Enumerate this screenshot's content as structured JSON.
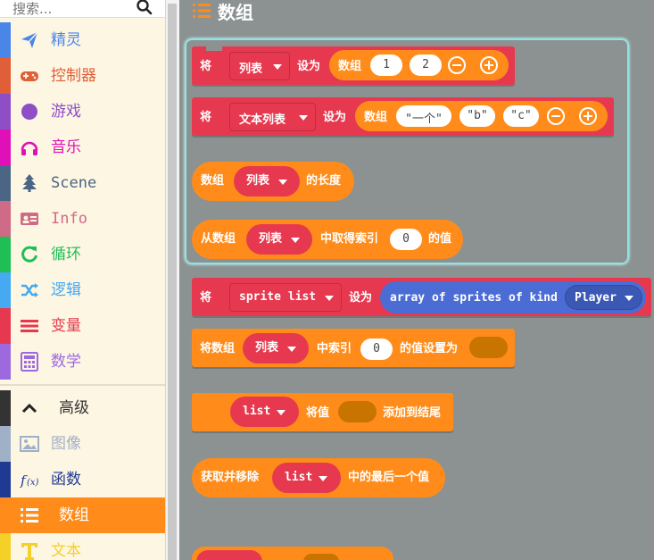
{
  "search": {
    "placeholder": "搜索..."
  },
  "categories": [
    {
      "label": "精灵",
      "color": "#4a86e8",
      "icon": "paper-plane-icon"
    },
    {
      "label": "控制器",
      "color": "#e05e38",
      "icon": "gamepad-icon"
    },
    {
      "label": "游戏",
      "color": "#8e4ec6",
      "icon": "circle-icon"
    },
    {
      "label": "音乐",
      "color": "#e010b8",
      "icon": "headphones-icon"
    },
    {
      "label": "Scene",
      "color": "#4b6584",
      "icon": "tree-icon"
    },
    {
      "label": "Info",
      "color": "#cf6a87",
      "icon": "id-card-icon"
    },
    {
      "label": "循环",
      "color": "#20bf55",
      "icon": "loop-icon"
    },
    {
      "label": "逻辑",
      "color": "#45aaf2",
      "icon": "shuffle-icon"
    },
    {
      "label": "变量",
      "color": "#e6394f",
      "icon": "list-lines-icon"
    },
    {
      "label": "数学",
      "color": "#9c6ade",
      "icon": "calculator-icon"
    },
    {
      "label": "高级",
      "color": "#333333",
      "icon": "chevron-up-icon"
    },
    {
      "label": "图像",
      "color": "#a0b0c6",
      "icon": "image-icon"
    },
    {
      "label": "函数",
      "color": "#1f3a93",
      "icon": "function-icon"
    },
    {
      "label": "数组",
      "color": "#ff8c1a",
      "icon": "list-icon"
    },
    {
      "label": "文本",
      "color": "#f5d027",
      "icon": "text-icon"
    }
  ],
  "flyout": {
    "title": "数组"
  },
  "blocks": {
    "b1": {
      "set": "将",
      "var": "列表",
      "to": "设为",
      "arr": "数组",
      "v1": "1",
      "v2": "2"
    },
    "b2": {
      "set": "将",
      "var": "文本列表",
      "to": "设为",
      "arr": "数组",
      "v1": "\"一个\"",
      "v2": "\"b\"",
      "v3": "\"c\""
    },
    "b3": {
      "arr": "数组",
      "var": "列表",
      "len": "的长度"
    },
    "b4": {
      "from": "从数组",
      "var": "列表",
      "get": "中取得索引",
      "idx": "0",
      "of": "的值"
    },
    "b5": {
      "set": "将",
      "var": "sprite list",
      "to": "设为",
      "sprites": "array of sprites of kind",
      "kind": "Player"
    },
    "b6": {
      "setarr": "将数组",
      "var": "列表",
      "idx_lbl": "中索引",
      "idx": "0",
      "setval": "的值设置为"
    },
    "b7": {
      "var": "list",
      "val": "将值",
      "append": "添加到结尾"
    },
    "b8": {
      "pop": "获取并移除",
      "var": "list",
      "last": "中的最后一个值"
    }
  }
}
